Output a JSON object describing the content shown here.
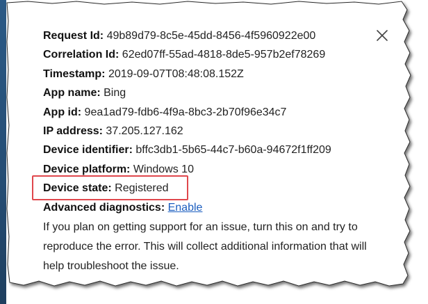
{
  "details": {
    "request_id": {
      "label": "Request Id:",
      "value": "49b89d79-8c5e-45dd-8456-4f5960922e00"
    },
    "correlation_id": {
      "label": "Correlation Id:",
      "value": "62ed07ff-55ad-4818-8de5-957b2ef78269"
    },
    "timestamp": {
      "label": "Timestamp:",
      "value": "2019-09-07T08:48:08.152Z"
    },
    "app_name": {
      "label": "App name:",
      "value": "Bing"
    },
    "app_id": {
      "label": "App id:",
      "value": "9ea1ad79-fdb6-4f9a-8bc3-2b70f96e34c7"
    },
    "ip_address": {
      "label": "IP address:",
      "value": "37.205.127.162"
    },
    "device_identifier": {
      "label": "Device identifier:",
      "value": "bffc3db1-5b65-44c7-b60a-94672f1ff209"
    },
    "device_platform": {
      "label": "Device platform:",
      "value": "Windows 10"
    },
    "device_state": {
      "label": "Device state:",
      "value": "Registered"
    },
    "advanced_diagnostics": {
      "label": "Advanced diagnostics:",
      "link": "Enable"
    }
  },
  "description": "If you plan on getting support for an issue, turn this on and try to reproduce the error. This will collect additional information that will help troubleshoot the issue.",
  "icons": {
    "close": "close-icon"
  },
  "colors": {
    "highlight": "#e0474c",
    "link": "#1a5dbf",
    "edge": "#2c5a86"
  }
}
